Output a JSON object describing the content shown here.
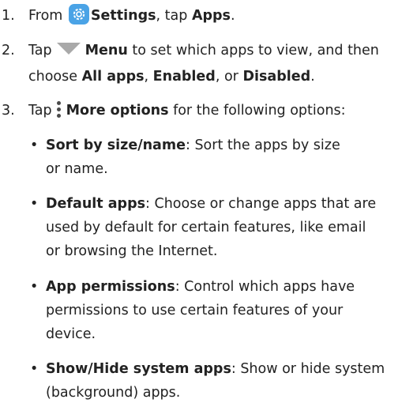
{
  "steps": [
    {
      "number": "1.",
      "parts": [
        "From",
        "Settings",
        ", tap",
        "Apps",
        "."
      ]
    },
    {
      "number": "2.",
      "parts": [
        "Tap",
        "Menu",
        "to set which apps to view, and then",
        "choose",
        "All apps",
        ",",
        "Enabled",
        ", or",
        "Disabled",
        "."
      ]
    },
    {
      "number": "3.",
      "parts": [
        "Tap",
        "More options",
        "for the following options:"
      ]
    }
  ],
  "options": [
    {
      "title": "Sort by size/name",
      "line1": ": Sort the apps by size",
      "line2": "or name."
    },
    {
      "title": "Default apps",
      "line1": ": Choose or change apps that are",
      "line2": "used by default for certain features, like email",
      "line3": "or browsing the Internet."
    },
    {
      "title": "App permissions",
      "line1": ": Control which apps have",
      "line2": "permissions to use certain features of your",
      "line3": "device."
    },
    {
      "title": "Show/Hide system apps",
      "line1": ": Show or hide system",
      "line2": "(background) apps."
    }
  ],
  "bullet_glyph": "•",
  "icons": {
    "settings": "gear-icon",
    "menu": "triangle-down-icon",
    "more": "vertical-dots-icon"
  },
  "colors": {
    "settings_icon_bg": "#4aa3e6",
    "menu_icon": "#a9a9a9",
    "text": "#222222"
  }
}
